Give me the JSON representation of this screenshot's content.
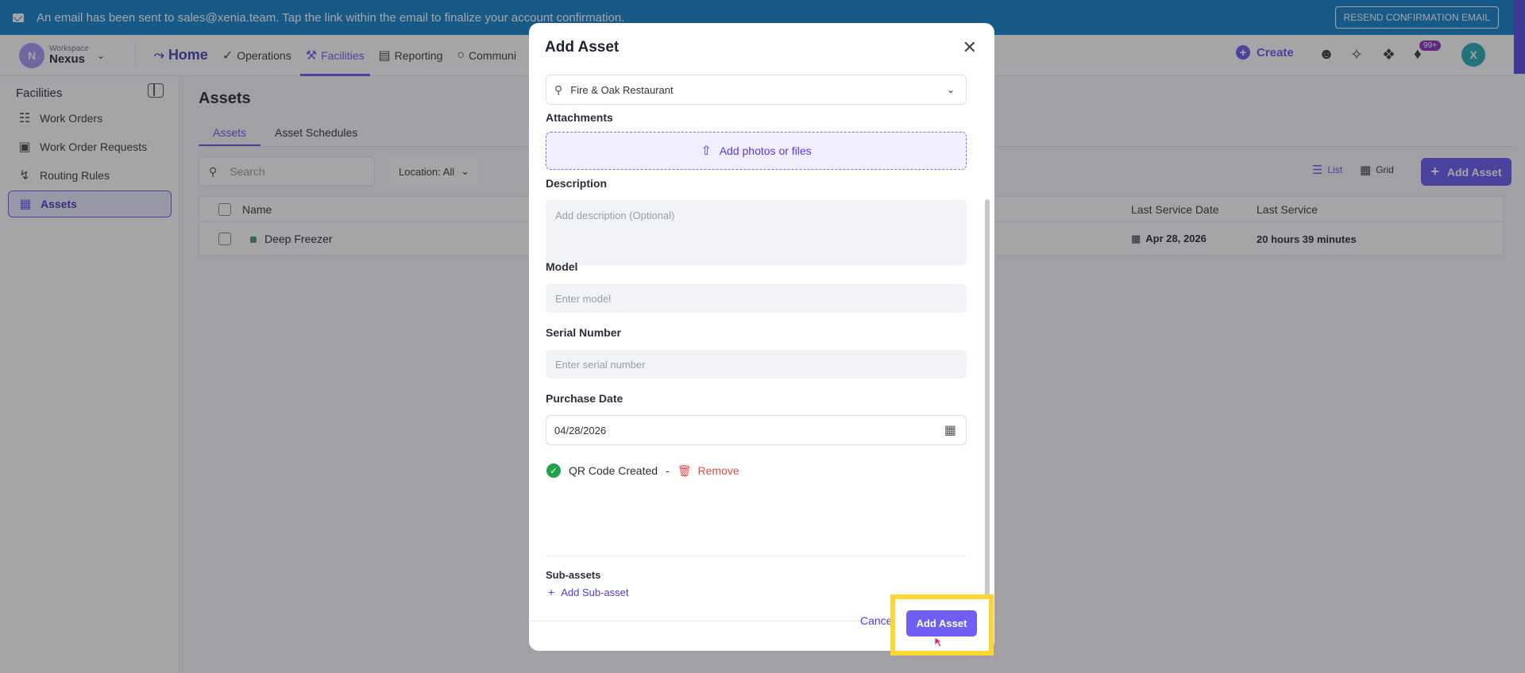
{
  "banner": {
    "message": "An email has been sent to sales@xenia.team. Tap the link within the email to finalize your account confirmation.",
    "resend_label": "RESEND CONFIRMATION EMAIL"
  },
  "workspace": {
    "label": "Workspace",
    "name": "Nexus",
    "initial": "N"
  },
  "nav": {
    "home": "Home",
    "items": [
      "Operations",
      "Facilities",
      "Reporting",
      "Communi"
    ],
    "create": "Create",
    "notifications_badge": "99+",
    "user_initial": "X"
  },
  "sidebar": {
    "title": "Facilities",
    "items": [
      "Work Orders",
      "Work Order Requests",
      "Routing Rules",
      "Assets"
    ]
  },
  "main": {
    "title": "Assets",
    "tabs": [
      "Assets",
      "Asset Schedules"
    ],
    "search_placeholder": "Search",
    "location_filter": "Location: All",
    "view_list": "List",
    "view_grid": "Grid",
    "add_asset": "Add Asset",
    "columns": {
      "name": "Name",
      "last_service_date": "Last Service Date",
      "last_service": "Last Service"
    },
    "rows": [
      {
        "name": "Deep Freezer",
        "last_service_date": "Apr 28, 2026",
        "last_service": "20 hours 39 minutes"
      }
    ]
  },
  "modal": {
    "title": "Add Asset",
    "location_value": "Fire & Oak Restaurant",
    "attachments_label": "Attachments",
    "upload_label": "Add photos or files",
    "description_label": "Description",
    "description_placeholder": "Add description (Optional)",
    "model_label": "Model",
    "model_placeholder": "Enter model",
    "serial_label": "Serial Number",
    "serial_placeholder": "Enter serial number",
    "purchase_label": "Purchase Date",
    "purchase_value": "04/28/2026",
    "qr_created": "QR Code Created",
    "qr_separator": "-",
    "remove_label": "Remove",
    "subassets_label": "Sub-assets",
    "add_subasset": "Add Sub-asset",
    "cancel_label": "Cance",
    "submit_label": "Add Asset"
  },
  "colors": {
    "accent": "#6357f0",
    "banner": "#0d7fc9",
    "highlight": "#ffd531",
    "success": "#1ea34a",
    "danger": "#e04a4a"
  }
}
